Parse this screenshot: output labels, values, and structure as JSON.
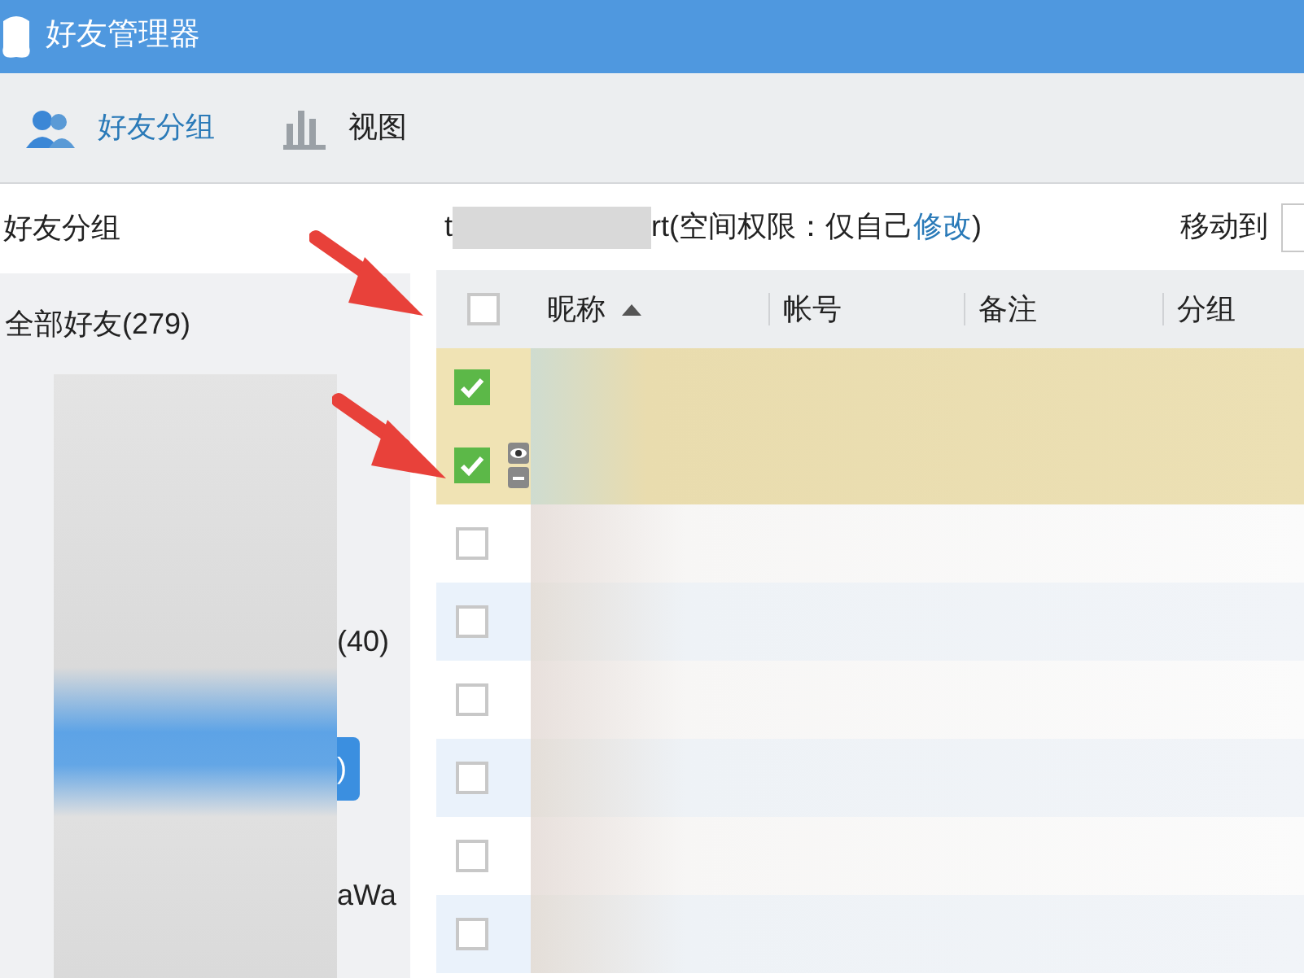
{
  "window": {
    "title": "好友管理器"
  },
  "tabs": [
    {
      "label": "好友分组",
      "selected": true
    },
    {
      "label": "视图",
      "selected": false
    }
  ],
  "sidebar": {
    "title": "好友分组",
    "items": [
      {
        "kind": "group",
        "text": "全部好友(279)",
        "selected": false
      },
      {
        "kind": "blurred"
      },
      {
        "kind": "blurred"
      },
      {
        "kind": "blurred"
      },
      {
        "kind": "blurred"
      },
      {
        "kind": "subgroup",
        "text": "(40)",
        "selected": false
      },
      {
        "kind": "blurred"
      },
      {
        "kind": "subgroup",
        "text": ")",
        "selected": true
      },
      {
        "kind": "blurred"
      },
      {
        "kind": "subgroup",
        "text": "aWa",
        "selected": false
      }
    ]
  },
  "group_info": {
    "prefix": "t",
    "suffix": "rt(空间权限：仅自己",
    "link": "修改",
    "close": ")"
  },
  "move_to": {
    "label": "移动到"
  },
  "table": {
    "select_all": false,
    "columns": [
      {
        "label": "昵称",
        "sorted": true
      },
      {
        "label": "帐号",
        "sorted": false
      },
      {
        "label": "备注",
        "sorted": false
      },
      {
        "label": "分组",
        "sorted": false
      }
    ],
    "rows": [
      {
        "checked": true,
        "hovered": false
      },
      {
        "checked": true,
        "hovered": true
      },
      {
        "checked": false,
        "hovered": false
      },
      {
        "checked": false,
        "hovered": false
      },
      {
        "checked": false,
        "hovered": false
      },
      {
        "checked": false,
        "hovered": false
      },
      {
        "checked": false,
        "hovered": false
      },
      {
        "checked": false,
        "hovered": false
      }
    ]
  }
}
